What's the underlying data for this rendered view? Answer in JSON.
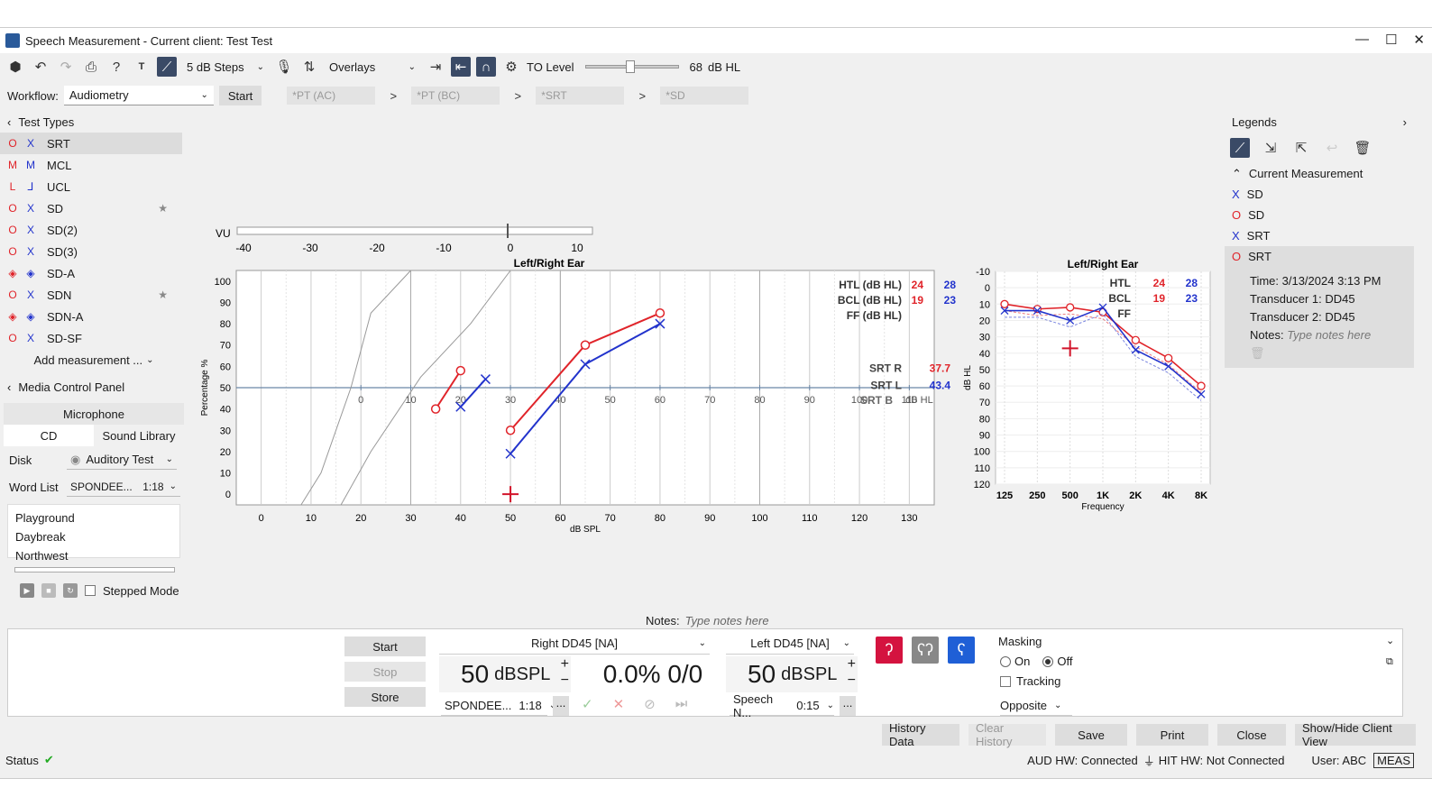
{
  "window": {
    "title": "Speech Measurement - Current client: Test Test"
  },
  "toolbar": {
    "steps": "5 dB Steps",
    "overlays": "Overlays",
    "to_level_label": "TO Level",
    "to_level_value": "68",
    "to_level_unit": "dB HL",
    "to_level_fraction": 0.47
  },
  "workflow": {
    "label": "Workflow:",
    "value": "Audiometry",
    "start": "Start",
    "steps": [
      "*PT (AC)",
      "*PT (BC)",
      "*SRT",
      "*SD"
    ],
    "arrow": ">"
  },
  "test_types": {
    "title": "Test Types",
    "items": [
      {
        "label": "SRT",
        "r": "O",
        "l": "X",
        "star": false,
        "selected": true
      },
      {
        "label": "MCL",
        "r": "M",
        "l": "M",
        "star": false
      },
      {
        "label": "UCL",
        "r": "L",
        "l": "⅃",
        "star": false
      },
      {
        "label": "SD",
        "r": "O",
        "l": "X",
        "star": true
      },
      {
        "label": "SD(2)",
        "r": "O",
        "l": "X",
        "star": false
      },
      {
        "label": "SD(3)",
        "r": "O",
        "l": "X",
        "star": false
      },
      {
        "label": "SD-A",
        "r": "◈",
        "l": "◈",
        "star": false
      },
      {
        "label": "SDN",
        "r": "O",
        "l": "X",
        "star": true
      },
      {
        "label": "SDN-A",
        "r": "◈",
        "l": "◈",
        "star": false
      },
      {
        "label": "SD-SF",
        "r": "O",
        "l": "X",
        "star": false
      }
    ],
    "add": "Add measurement ...",
    "star_glyph": "★"
  },
  "media": {
    "title": "Media Control Panel",
    "microphone": "Microphone",
    "tabs": [
      "CD",
      "Sound Library"
    ],
    "disk_label": "Disk",
    "disk_value": "Auditory Test",
    "wordlist_label": "Word List",
    "wordlist_value": "SPONDEE...",
    "wordlist_time": "1:18",
    "words": [
      "Playground",
      "Daybreak",
      "Northwest"
    ],
    "stepped": "Stepped Mode"
  },
  "vu": {
    "label": "VU",
    "ticks": [
      "-40",
      "-30",
      "-20",
      "-10",
      "0",
      "10"
    ]
  },
  "chart_data": [
    {
      "type": "line",
      "title": "Left/Right Ear",
      "xlabel": "dB SPL",
      "ylabel": "Percentage %",
      "xlim": [
        -5,
        135
      ],
      "ylim": [
        -5,
        105
      ],
      "x_ticks": [
        "0",
        "10",
        "20",
        "30",
        "40",
        "50",
        "60",
        "70",
        "80",
        "90",
        "100",
        "110",
        "120",
        "130"
      ],
      "y_ticks": [
        "0",
        "10",
        "20",
        "30",
        "40",
        "50",
        "60",
        "70",
        "80",
        "90",
        "100"
      ],
      "hl_ticks": [
        "0",
        "10",
        "20",
        "30",
        "40",
        "50",
        "60",
        "70",
        "80",
        "90",
        "100",
        "110"
      ],
      "hl_unit": "dB HL",
      "series": [
        {
          "color": "#e0242a",
          "marker": "circle",
          "points": [
            [
              35,
              40
            ],
            [
              40,
              58
            ]
          ]
        },
        {
          "color": "#2233cc",
          "marker": "x",
          "points": [
            [
              40,
              41
            ],
            [
              45,
              54
            ]
          ]
        },
        {
          "color": "#e0242a",
          "marker": "circle",
          "points": [
            [
              50,
              30
            ],
            [
              65,
              70
            ],
            [
              80,
              85
            ]
          ]
        },
        {
          "color": "#2233cc",
          "marker": "x",
          "points": [
            [
              50,
              19
            ],
            [
              65,
              61
            ],
            [
              80,
              80
            ]
          ]
        }
      ],
      "summary": {
        "htl_label": "HTL (dB HL)",
        "htl_r": "24",
        "htl_l": "28",
        "bcl_label": "BCL (dB HL)",
        "bcl_r": "19",
        "bcl_l": "23",
        "ff_label": "FF (dB HL)",
        "srtr_label": "SRT R",
        "srtr": "37.7",
        "srtl_label": "SRT L",
        "srtl": "43.4",
        "srtb_label": "SRT B"
      }
    },
    {
      "type": "line",
      "title": "Left/Right Ear",
      "xlabel": "Frequency",
      "ylabel": "dB HL",
      "ylim": [
        -10,
        120
      ],
      "categories": [
        "125",
        "250",
        "500",
        "1K",
        "2K",
        "4K",
        "8K"
      ],
      "y_ticks": [
        "-10",
        "0",
        "10",
        "20",
        "30",
        "40",
        "50",
        "60",
        "70",
        "80",
        "90",
        "100",
        "110",
        "120"
      ],
      "series": [
        {
          "color": "#e0242a",
          "marker": "circle",
          "values": [
            10,
            13,
            12,
            15,
            32,
            43,
            60
          ]
        },
        {
          "color": "#2233cc",
          "marker": "x",
          "values": [
            14,
            14,
            20,
            12,
            38,
            48,
            65
          ]
        }
      ],
      "summary": {
        "htl_label": "HTL",
        "htl_r": "24",
        "htl_l": "28",
        "bcl_label": "BCL",
        "bcl_r": "19",
        "bcl_l": "23",
        "ff_label": "FF"
      }
    }
  ],
  "legends": {
    "title": "Legends",
    "current": "Current Measurement",
    "items": [
      {
        "sym": "X",
        "label": "SD",
        "color": "#2233cc"
      },
      {
        "sym": "O",
        "label": "SD",
        "color": "#e0242a"
      },
      {
        "sym": "X",
        "label": "SRT",
        "color": "#2233cc"
      },
      {
        "sym": "O",
        "label": "SRT",
        "color": "#e0242a"
      }
    ],
    "time": "Time: 3/13/2024 3:13 PM",
    "t1": "Transducer 1: DD45",
    "t2": "Transducer 2: DD45",
    "notes_label": "Notes:",
    "notes_ph": "Type notes here"
  },
  "notes": {
    "label": "Notes:",
    "placeholder": "Type notes here"
  },
  "control": {
    "start": "Start",
    "stop": "Stop",
    "store": "Store",
    "right_trans": "Right DD45 [NA]",
    "left_trans": "Left DD45 [NA]",
    "right_level": "50",
    "left_level": "50",
    "unit": "dBSPL",
    "score": "0.0% 0/0",
    "right_list": "SPONDEE...",
    "right_time": "1:18",
    "left_list": "Speech N...",
    "left_time": "0:15",
    "more": "...",
    "masking": "Masking",
    "on": "On",
    "off": "Off",
    "tracking": "Tracking",
    "opposite": "Opposite"
  },
  "actions": [
    "History Data",
    "Clear History",
    "Save",
    "Print",
    "Close",
    "Show/Hide Client View"
  ],
  "status": {
    "label": "Status",
    "aud": "AUD HW: Connected",
    "hit": "HIT HW: Not Connected",
    "user": "User: ABC",
    "mode": "MEAS"
  }
}
